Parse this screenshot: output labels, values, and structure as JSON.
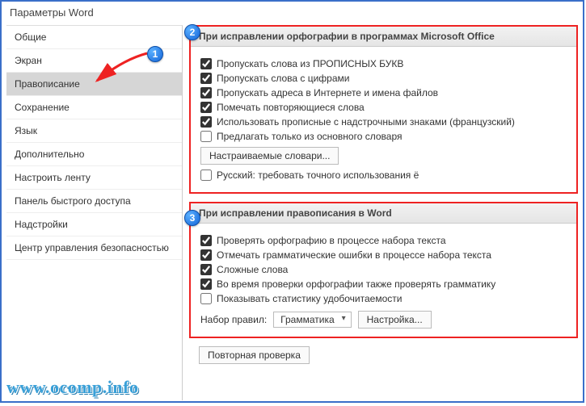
{
  "window": {
    "title": "Параметры Word"
  },
  "sidebar": {
    "items": [
      {
        "label": "Общие"
      },
      {
        "label": "Экран"
      },
      {
        "label": "Правописание"
      },
      {
        "label": "Сохранение"
      },
      {
        "label": "Язык"
      },
      {
        "label": "Дополнительно"
      },
      {
        "label": "Настроить ленту"
      },
      {
        "label": "Панель быстрого доступа"
      },
      {
        "label": "Надстройки"
      },
      {
        "label": "Центр управления безопасностью"
      }
    ]
  },
  "group1": {
    "title": "При исправлении орфографии в программах Microsoft Office",
    "opts": [
      "Пропускать слова из ПРОПИСНЫХ БУКВ",
      "Пропускать слова с цифрами",
      "Пропускать адреса в Интернете и имена файлов",
      "Помечать повторяющиеся слова",
      "Использовать прописные с надстрочными знаками (французский)",
      "Предлагать только из основного словаря"
    ],
    "dict_btn": "Настраиваемые словари...",
    "russian_yo": "Русский: требовать точного использования ё"
  },
  "group2": {
    "title": "При исправлении правописания в Word",
    "opts": [
      "Проверять орфографию в процессе набора текста",
      "Отмечать грамматические ошибки в процессе набора текста",
      "Сложные слова",
      "Во время проверки орфографии также проверять грамматику",
      "Показывать статистику удобочитаемости"
    ],
    "ruleset_label": "Набор правил:",
    "ruleset_value": "Грамматика",
    "settings_btn": "Настройка..."
  },
  "recheck_btn": "Повторная проверка",
  "badges": {
    "b1": "1",
    "b2": "2",
    "b3": "3"
  },
  "watermark": "www.ocomp.info"
}
